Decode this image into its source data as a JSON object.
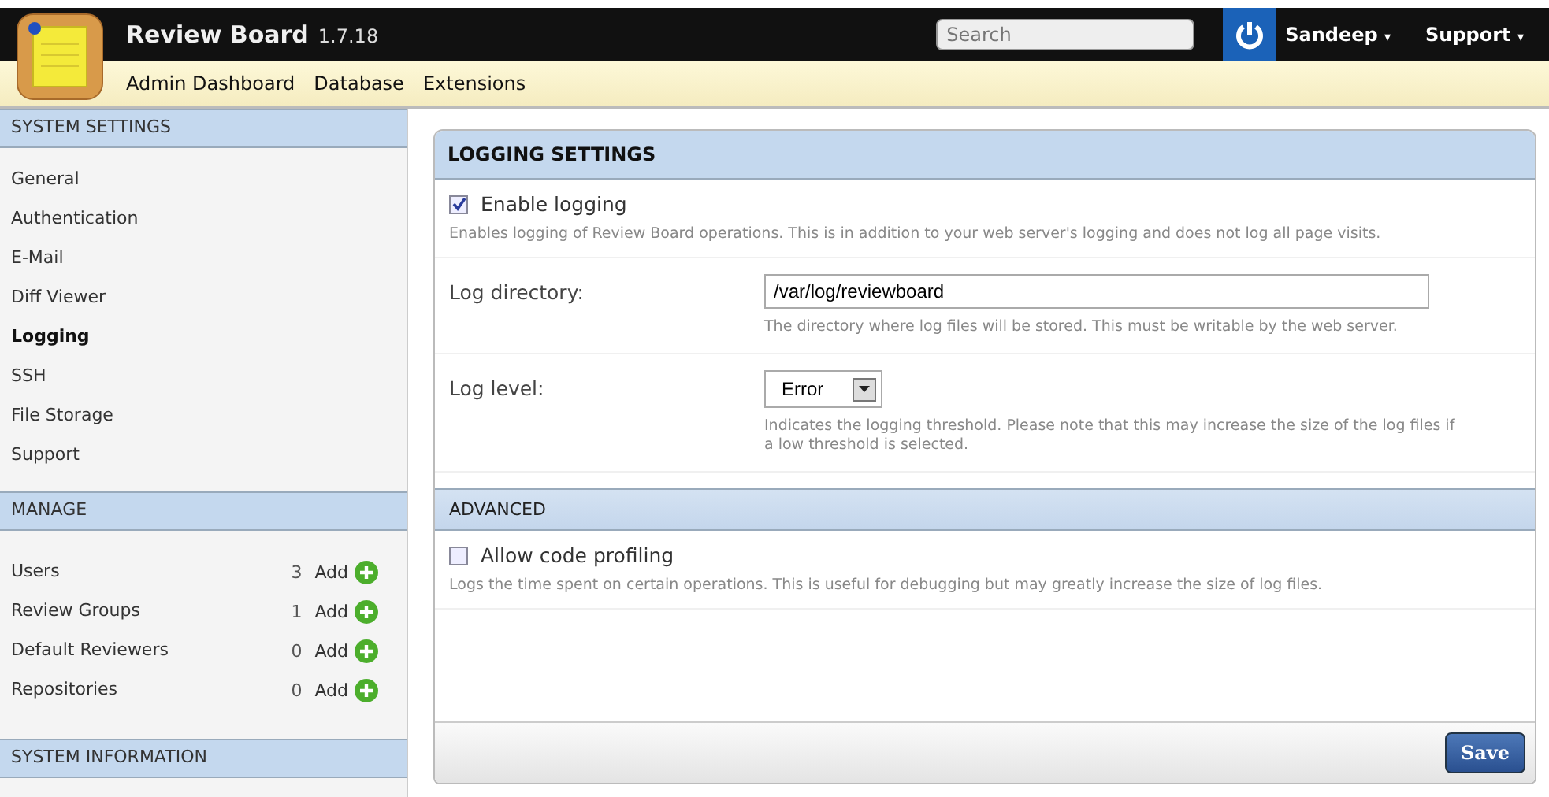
{
  "header": {
    "title": "Review Board",
    "version": "1.7.18",
    "search": {
      "placeholder": "Search"
    },
    "user": "Sandeep",
    "support": "Support",
    "caret": "▾"
  },
  "nav": [
    "Admin Dashboard",
    "Database",
    "Extensions"
  ],
  "sidebar": {
    "sections": [
      {
        "title": "SYSTEM SETTINGS",
        "kind": "links",
        "items": [
          {
            "label": "General",
            "selected": false
          },
          {
            "label": "Authentication",
            "selected": false
          },
          {
            "label": "E-Mail",
            "selected": false
          },
          {
            "label": "Diff Viewer",
            "selected": false
          },
          {
            "label": "Logging",
            "selected": true
          },
          {
            "label": "SSH",
            "selected": false
          },
          {
            "label": "File Storage",
            "selected": false
          },
          {
            "label": "Support",
            "selected": false
          }
        ]
      },
      {
        "title": "MANAGE",
        "kind": "counts",
        "items": [
          {
            "label": "Users",
            "count": "3",
            "action": "Add"
          },
          {
            "label": "Review Groups",
            "count": "1",
            "action": "Add"
          },
          {
            "label": "Default Reviewers",
            "count": "0",
            "action": "Add"
          },
          {
            "label": "Repositories",
            "count": "0",
            "action": "Add"
          }
        ]
      },
      {
        "title": "SYSTEM INFORMATION"
      }
    ]
  },
  "panel": {
    "title": "LOGGING SETTINGS",
    "sections": [
      {
        "fields": [
          {
            "kind": "checkbox",
            "label": "Enable logging",
            "checked": true,
            "help": "Enables logging of Review Board operations. This is in addition to your web server's logging and does not log all page visits."
          },
          {
            "kind": "text",
            "label": "Log directory:",
            "value": "/var/log/reviewboard",
            "help": "The directory where log files will be stored. This must be writable by the web server."
          },
          {
            "kind": "select",
            "label": "Log level:",
            "value": "Error",
            "help": "Indicates the logging threshold. Please note that this may increase the size of the log files if a low threshold is selected."
          }
        ]
      },
      {
        "title": "ADVANCED",
        "fields": [
          {
            "kind": "checkbox",
            "label": "Allow code profiling",
            "checked": false,
            "help": "Logs the time spent on certain operations. This is useful for debugging but may greatly increase the size of log files."
          }
        ]
      }
    ],
    "save": "Save"
  }
}
